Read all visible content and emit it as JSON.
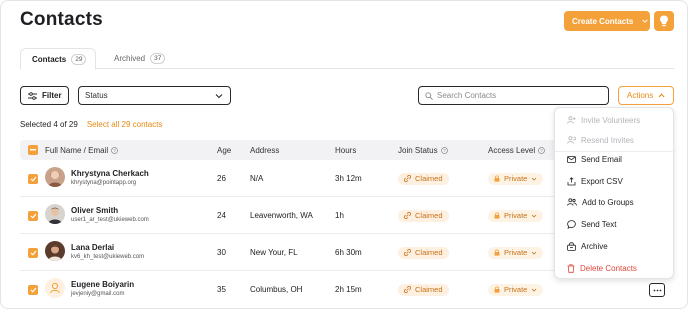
{
  "page": {
    "title": "Contacts"
  },
  "header": {
    "create_label": "Create Contacts"
  },
  "tabs": [
    {
      "label": "Contacts",
      "count": "29"
    },
    {
      "label": "Archived",
      "count": "37"
    }
  ],
  "toolbar": {
    "filter_label": "Filter",
    "status_value": "Status",
    "search_placeholder": "Search Contacts",
    "actions_label": "Actions"
  },
  "selection": {
    "text": "Selected 4 of 29",
    "select_all": "Select all 29 contacts"
  },
  "table": {
    "headers": {
      "name": "Full Name / Email",
      "age": "Age",
      "address": "Address",
      "hours": "Hours",
      "join": "Join Status",
      "access": "Access Level"
    },
    "rows": [
      {
        "name": "Khrystyna Cherkach",
        "email": "khrystyna@pointapp.org",
        "age": "26",
        "address": "N/A",
        "hours": "3h 12m",
        "join": "Claimed",
        "access": "Private"
      },
      {
        "name": "Oliver Smith",
        "email": "user1_ar_test@ukieweb.com",
        "age": "24",
        "address": "Leavenworth, WA",
        "hours": "1h",
        "join": "Claimed",
        "access": "Private"
      },
      {
        "name": "Lana Derlai",
        "email": "kv6_kh_test@ukieweb.com",
        "age": "30",
        "address": "New Your, FL",
        "hours": "6h 30m",
        "join": "Claimed",
        "access": "Private"
      },
      {
        "name": "Eugene Boiyarin",
        "email": "jevjeniy@gmail.com",
        "age": "35",
        "address": "Columbus, OH",
        "hours": "2h 15m",
        "join": "Claimed",
        "access": "Private"
      }
    ]
  },
  "actions_menu": {
    "invite": "Invite Volunteers",
    "resend": "Resend Invites",
    "send_email": "Send Email",
    "export": "Export CSV",
    "add_groups": "Add to Groups",
    "send_text": "Send Text",
    "archive": "Archive",
    "delete": "Delete Contacts"
  },
  "colors": {
    "accent": "#f5a13a",
    "danger": "#e0473c",
    "pill_bg": "#fdf0e0"
  }
}
